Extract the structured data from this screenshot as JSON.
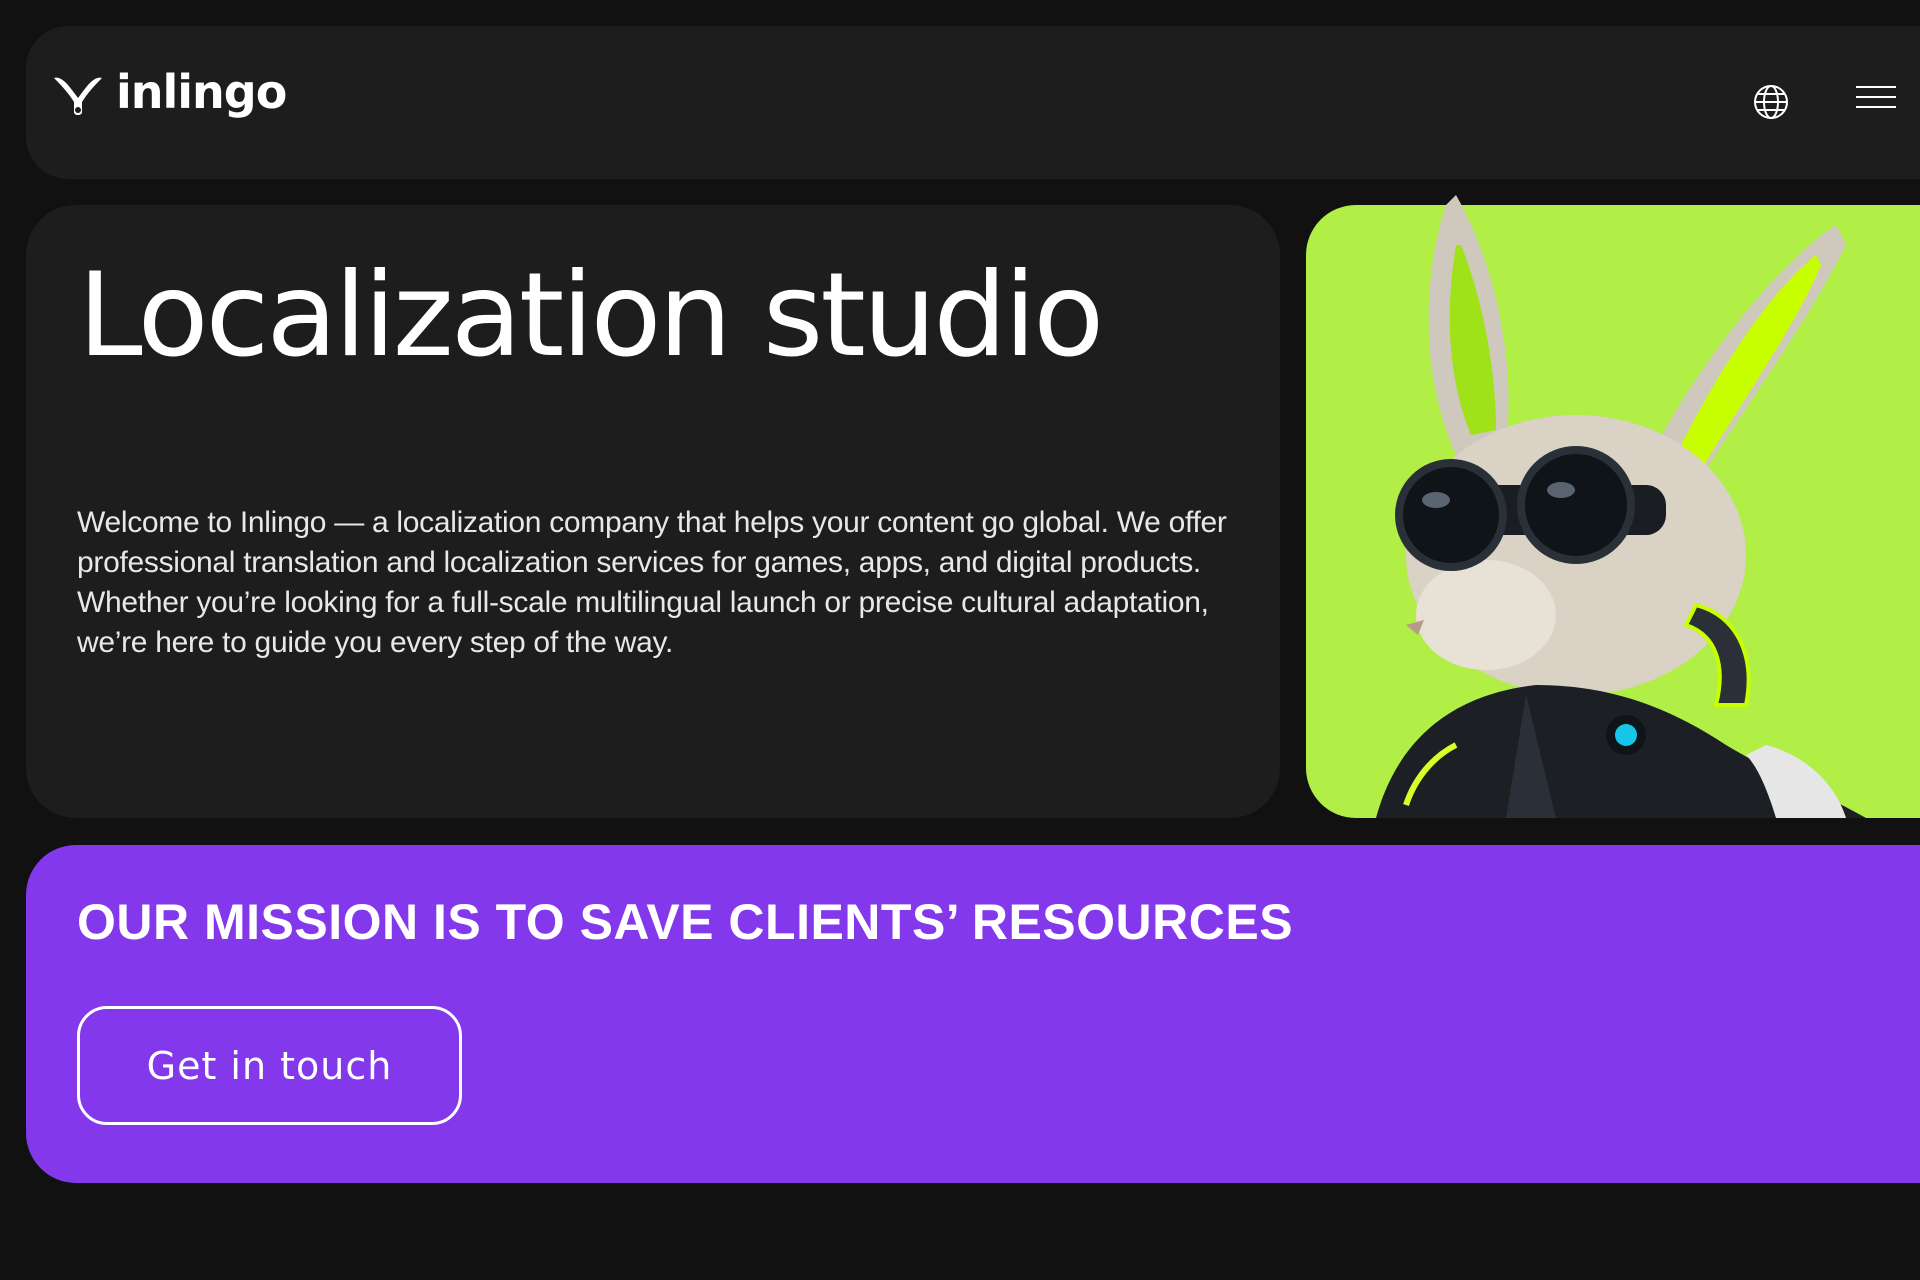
{
  "header": {
    "logo_text": "inlingo",
    "icons": {
      "language": "globe-icon",
      "menu": "hamburger-menu-icon",
      "logo": "inlingo-logo-mark-icon"
    }
  },
  "hero": {
    "title": "Localization studio",
    "description": "Welcome to Inlingo — a localization company that helps your content go global. We offer professional translation and localization services for games, apps, and digital products. Whether you’re looking for a full-scale multilingual launch or precise cultural adaptation, we’re here to guide you every step of the way.",
    "image": "rabbit-with-goggles-illustration"
  },
  "mission": {
    "title": "OUR MISSION IS TO SAVE CLIENTS’ RESOURCES",
    "cta_label": "Get in touch"
  },
  "colors": {
    "background": "#111111",
    "card": "#1d1d1d",
    "accent_green": "#b1ee46",
    "accent_purple": "#8338ec",
    "text": "#ffffff"
  }
}
